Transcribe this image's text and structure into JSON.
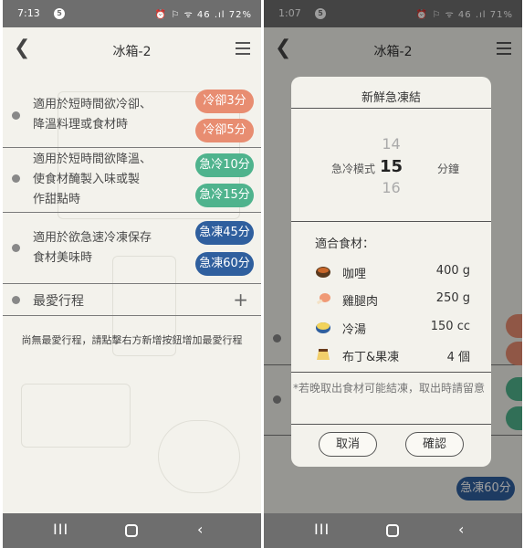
{
  "left_screen": {
    "status": {
      "time": "7:13",
      "notif_badge": "5",
      "icons": "⏰ ⚐ ᯤ 46 .ıl",
      "battery": "72%"
    },
    "appbar": {
      "title": "冰箱-2"
    },
    "modes": [
      {
        "desc_lines": [
          "適用於短時間欲冷卻、",
          "降溫料理或食材時"
        ],
        "buttons": [
          "冷卻3分",
          "冷卻5分"
        ]
      },
      {
        "desc_lines": [
          "適用於短時間欲降溫、",
          "使食材醃製入味或製",
          "作甜點時"
        ],
        "buttons": [
          "急冷10分",
          "急冷15分"
        ]
      },
      {
        "desc_lines": [
          "適用於欲急速冷凍保存",
          "食材美味時"
        ],
        "buttons": [
          "急凍45分",
          "急凍60分"
        ]
      }
    ],
    "favorites": {
      "label": "最愛行程",
      "add_symbol": "+",
      "empty_message": "尚無最愛行程，請點擊右方新增按鈕增加最愛行程"
    },
    "navbar": {
      "recent": "III",
      "back": "‹"
    }
  },
  "right_screen": {
    "status": {
      "time": "1:07",
      "notif_badge": "5",
      "icons": "⏰ ⚐ ᯤ 46 .ıl",
      "battery": "71%"
    },
    "appbar": {
      "title": "冰箱-2"
    },
    "background_peek": {
      "pill_top": "急凍60分"
    },
    "dialog": {
      "title": "新鮮急凍結",
      "picker": {
        "label": "急冷模式",
        "prev": "14",
        "current": "15",
        "next": "16",
        "unit": "分鐘"
      },
      "foods_header": "適合食材：",
      "foods": [
        {
          "icon": "curry-icon",
          "name": "咖哩",
          "amount": "400 g"
        },
        {
          "icon": "drumstick-icon",
          "name": "雞腿肉",
          "amount": "250 g"
        },
        {
          "icon": "soup-icon",
          "name": "冷湯",
          "amount": "150 cc"
        },
        {
          "icon": "pudding-icon",
          "name": "布丁&果凍",
          "amount": "4 個"
        }
      ],
      "warning": "*若晚取出食材可能結凍，取出時請留意",
      "cancel_label": "取消",
      "confirm_label": "確認"
    },
    "navbar": {
      "recent": "III",
      "back": "‹"
    }
  },
  "colors": {
    "cool": "#e88d71",
    "chill": "#4fb38d",
    "freeze": "#2f5f9e"
  }
}
